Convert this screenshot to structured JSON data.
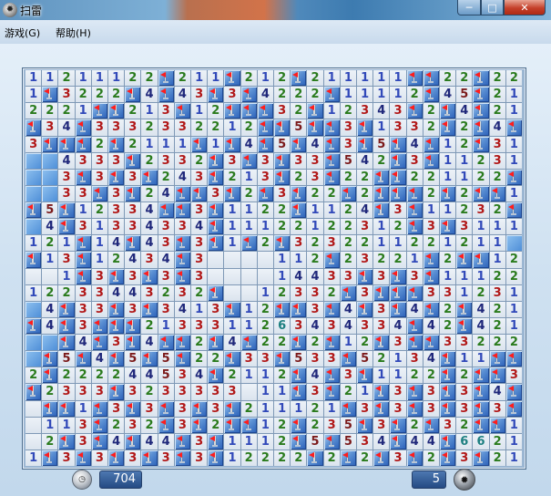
{
  "window": {
    "title": "扫雷",
    "controls": {
      "minimize": "─",
      "maximize": "□",
      "close": "✕"
    }
  },
  "menu": {
    "items": [
      "游戏(G)",
      "帮助(H)"
    ]
  },
  "icons": {
    "app": "mine-icon",
    "timer": "stopwatch-icon",
    "mines": "mine-icon"
  },
  "colors": {
    "n1": "#3149b9",
    "n2": "#2a7b1d",
    "n3": "#b11818",
    "n4": "#1f277a",
    "n5": "#7b1a1a",
    "n6": "#1d7f80",
    "flag": "#ff1d1d"
  },
  "status": {
    "timer": "704",
    "mines_left": "5"
  },
  "board": {
    "cols": 30,
    "rows": 24,
    "legend": {
      "F": "flag",
      "#": "covered",
      "0": "empty open",
      "1-8": "count"
    },
    "grid": [
      "11211122F211F212F211111FF22F22",
      "1F3222F4F43F3F4222F11112F45F21",
      "2221FF213F12FFF32F12343F2F4F21",
      "F34F3332332212FF5FF3F1332F2F4F",
      "3FFF2F2111F1F4F5F4F3F5F4F12F31",
      "##4333F2332F3F3F33F542F3F11231",
      "##3F3F3F243F213F23F22FF221122F",
      "##33F3F24FF3F2F3F22F2FFF2F2FF1",
      "F5F12334FF3F1122F1124F3F11232F",
      "#4F31334334F11122122312F3F3111",
      "121F14F43F3F1F2F3232211221211#",
      "F13F12434F30000112F23221F2FF12",
      "001F3F3F3F3000014433F3F3F11122",
      "12233443232F0012332F3FFF331231",
      "#4F33F3F3413F12FF3F4F3F4F2F421",
      "F4F3FFF2133311263434334F42F421",
      "##F4F3F4FF2F4F22F2F12F3FF33222",
      "#F5F4F5F5F22F33F533F52134F11FF",
      "2F222244534F2112F4F3F1122F2FF3",
      "F2333F3233333011F3F21F3F3F3F4F",
      "0FF1F3F3F3F3F211121F3F3F3F3F3F",
      "0113F232F3F2FF12F235F3F2F32FF1",
      "02F3F4F44F3F1112F5F534F44F6621",
      "1F3F3F3F3F3F12222F2F2F3F2F3F21"
    ]
  }
}
